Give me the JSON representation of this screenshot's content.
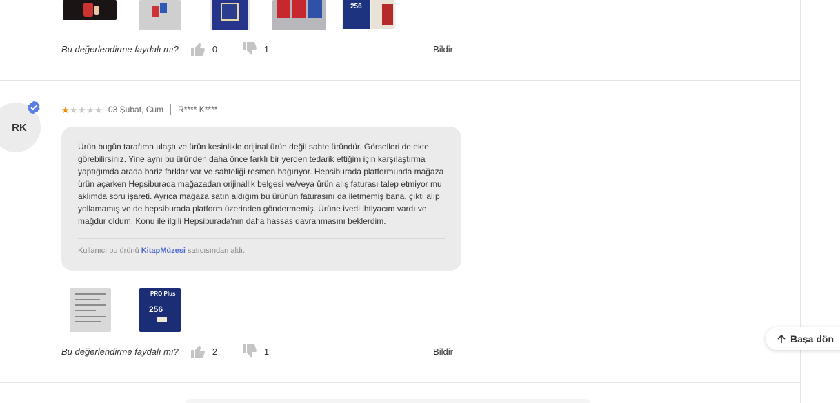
{
  "review1": {
    "helpful_question": "Bu değerlendirme faydalı mı?",
    "likes": "0",
    "dislikes": "1",
    "report_label": "Bildir",
    "images": [
      {
        "icon": "photo-hand-red-card"
      },
      {
        "icon": "photo-cards"
      },
      {
        "icon": "photo-pro-plus-package"
      },
      {
        "icon": "photo-samsung-cards"
      },
      {
        "icon": "photo-evo-256-package"
      }
    ]
  },
  "review2": {
    "avatar_initials": "RK",
    "rating": 1,
    "rating_max": 5,
    "date": "03 Şubat, Cum",
    "author": "R**** K****",
    "body": "Ürün bugün tarafıma ulaştı ve ürün kesinlikle orijinal ürün değil sahte üründür. Görselleri de ekte görebilirsiniz. Yine aynı bu üründen daha önce farklı bir yerden tedarik ettiğim için karşılaştırma yaptığımda arada bariz farklar var ve sahteliği resmen bağırıyor. Hepsiburada platformunda mağaza ürün açarken Hepsiburada mağazadan orijinallik belgesi ve/veya ürün alış faturası talep etmiyor mu aklımda soru işareti. Ayrıca mağaza satın aldığım bu ürünün faturasını da iletmemiş bana, çıktı alıp yollamamış ve de hepsiburada platform üzerinden göndermemiş. Ürüne ivedi ihtiyacım vardı ve mağdur oldum. Konu ile ilgili Hepsiburada'nın daha hassas davranmasını beklerdim.",
    "seller_prefix": "Kullanıcı bu ürünü ",
    "seller_name": "KitapMüzesi",
    "seller_suffix": " satıcısından aldı.",
    "images": [
      {
        "icon": "photo-package-back"
      },
      {
        "icon": "photo-package-front",
        "brand": "PRO Plus",
        "capacity": "256"
      }
    ],
    "helpful_question": "Bu değerlendirme faydalı mı?",
    "likes": "2",
    "dislikes": "1",
    "report_label": "Bildir"
  },
  "back_to_top": {
    "label": "Başa dön",
    "icon": "arrow-up-icon"
  },
  "colors": {
    "star_on": "#f28b00",
    "star_off": "#c8c8c8",
    "link": "#4e6bd0",
    "verified": "#5a7ee6",
    "bubble_bg": "#ebebeb"
  }
}
